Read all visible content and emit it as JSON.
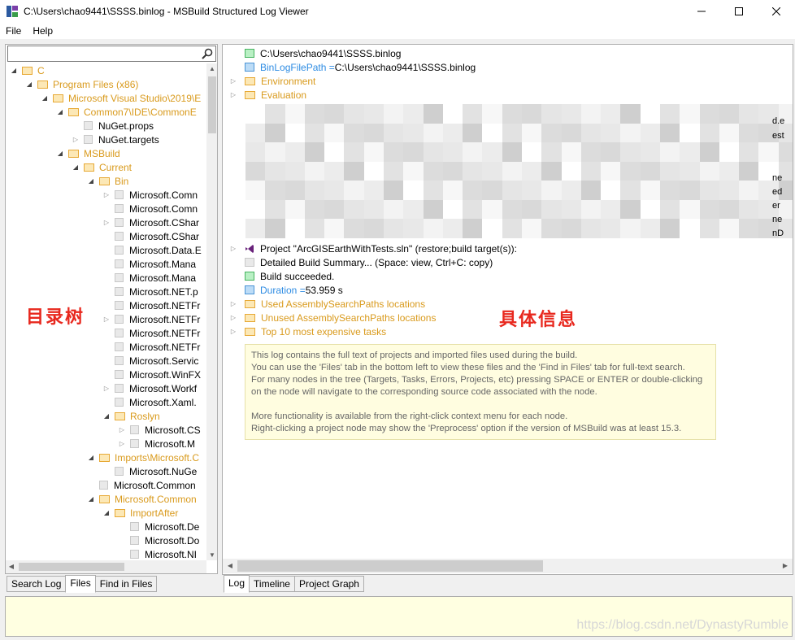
{
  "window": {
    "title": "C:\\Users\\chao9441\\SSSS.binlog - MSBuild Structured Log Viewer",
    "icon": "msbuild-app-icon"
  },
  "menu": [
    "File",
    "Help"
  ],
  "search": {
    "value": "",
    "placeholder": ""
  },
  "tree": [
    {
      "depth": 0,
      "label": "C",
      "kind": "folder",
      "expander": "open"
    },
    {
      "depth": 1,
      "label": "Program Files (x86)",
      "kind": "folder",
      "expander": "open"
    },
    {
      "depth": 2,
      "label": "Microsoft Visual Studio\\2019\\E",
      "kind": "folder",
      "expander": "open"
    },
    {
      "depth": 3,
      "label": "Common7\\IDE\\CommonE",
      "kind": "folder",
      "expander": "open"
    },
    {
      "depth": 4,
      "label": "NuGet.props",
      "kind": "file",
      "expander": "none"
    },
    {
      "depth": 4,
      "label": "NuGet.targets",
      "kind": "file",
      "expander": "closed"
    },
    {
      "depth": 3,
      "label": "MSBuild",
      "kind": "folder",
      "expander": "open"
    },
    {
      "depth": 4,
      "label": "Current",
      "kind": "folder",
      "expander": "open"
    },
    {
      "depth": 5,
      "label": "Bin",
      "kind": "folder",
      "expander": "open"
    },
    {
      "depth": 6,
      "label": "Microsoft.Comn",
      "kind": "file",
      "expander": "closed"
    },
    {
      "depth": 6,
      "label": "Microsoft.Comn",
      "kind": "file",
      "expander": "none"
    },
    {
      "depth": 6,
      "label": "Microsoft.CShar",
      "kind": "file",
      "expander": "closed"
    },
    {
      "depth": 6,
      "label": "Microsoft.CShar",
      "kind": "file",
      "expander": "none"
    },
    {
      "depth": 6,
      "label": "Microsoft.Data.E",
      "kind": "file",
      "expander": "none"
    },
    {
      "depth": 6,
      "label": "Microsoft.Mana",
      "kind": "file",
      "expander": "none"
    },
    {
      "depth": 6,
      "label": "Microsoft.Mana",
      "kind": "file",
      "expander": "none"
    },
    {
      "depth": 6,
      "label": "Microsoft.NET.p",
      "kind": "file",
      "expander": "none"
    },
    {
      "depth": 6,
      "label": "Microsoft.NETFr",
      "kind": "file",
      "expander": "none"
    },
    {
      "depth": 6,
      "label": "Microsoft.NETFr",
      "kind": "file",
      "expander": "closed"
    },
    {
      "depth": 6,
      "label": "Microsoft.NETFr",
      "kind": "file",
      "expander": "none"
    },
    {
      "depth": 6,
      "label": "Microsoft.NETFr",
      "kind": "file",
      "expander": "none"
    },
    {
      "depth": 6,
      "label": "Microsoft.Servic",
      "kind": "file",
      "expander": "none"
    },
    {
      "depth": 6,
      "label": "Microsoft.WinFX",
      "kind": "file",
      "expander": "none"
    },
    {
      "depth": 6,
      "label": "Microsoft.Workf",
      "kind": "file",
      "expander": "closed"
    },
    {
      "depth": 6,
      "label": "Microsoft.Xaml.",
      "kind": "file",
      "expander": "none"
    },
    {
      "depth": 6,
      "label": "Roslyn",
      "kind": "folder",
      "expander": "open"
    },
    {
      "depth": 7,
      "label": "Microsoft.CS",
      "kind": "file",
      "expander": "closed"
    },
    {
      "depth": 7,
      "label": "Microsoft.M",
      "kind": "file",
      "expander": "closed"
    },
    {
      "depth": 5,
      "label": "Imports\\Microsoft.C",
      "kind": "folder",
      "expander": "open"
    },
    {
      "depth": 6,
      "label": "Microsoft.NuGe",
      "kind": "file",
      "expander": "none"
    },
    {
      "depth": 5,
      "label": "Microsoft.Common",
      "kind": "file",
      "expander": "none"
    },
    {
      "depth": 5,
      "label": "Microsoft.Common",
      "kind": "folder",
      "expander": "open"
    },
    {
      "depth": 6,
      "label": "ImportAfter",
      "kind": "folder",
      "expander": "open"
    },
    {
      "depth": 7,
      "label": "Microsoft.De",
      "kind": "file",
      "expander": "none"
    },
    {
      "depth": 7,
      "label": "Microsoft.Do",
      "kind": "file",
      "expander": "none"
    },
    {
      "depth": 7,
      "label": "Microsoft.NI",
      "kind": "file",
      "expander": "none"
    }
  ],
  "left_tabs": [
    "Search Log",
    "Files",
    "Find in Files"
  ],
  "left_active_tab": "Files",
  "log": {
    "binlog_path": "C:\\Users\\chao9441\\SSSS.binlog",
    "binlog_prop_name": "BinLogFilePath = ",
    "binlog_prop_value": "C:\\Users\\chao9441\\SSSS.binlog",
    "environment": "Environment",
    "evaluation": "Evaluation",
    "side_fragments": [
      "d.e",
      "est",
      "ne",
      "ed",
      "er",
      "ne",
      "nD"
    ],
    "project": "Project \"ArcGISEarthWithTests.sln\" (restore;build target(s)):",
    "summary": "Detailed Build Summary... (Space: view, Ctrl+C: copy)",
    "build_status": "Build succeeded.",
    "duration_name": "Duration = ",
    "duration_value": "53.959 s",
    "used_paths": "Used AssemblySearchPaths locations",
    "unused_paths": "Unused AssemblySearchPaths locations",
    "top_tasks": "Top 10 most expensive tasks",
    "info": [
      "This log contains the full text of projects and imported files used during the build.",
      "You can use the 'Files' tab in the bottom left to view these files and the 'Find in Files' tab for full-text search.",
      "For many nodes in the tree (Targets, Tasks, Errors, Projects, etc) pressing SPACE or ENTER or double-clicking",
      "on the node will navigate to the corresponding source code associated with the node.",
      "",
      "More functionality is available from the right-click context menu for each node.",
      "Right-clicking a project node may show the 'Preprocess' option if the version of MSBuild was at least 15.3."
    ]
  },
  "right_tabs": [
    "Log",
    "Timeline",
    "Project Graph"
  ],
  "right_active_tab": "Log",
  "annotations": {
    "left": "目录树",
    "right": "具体信息"
  },
  "watermark": "https://blog.csdn.net/DynastyRumble",
  "colors": {
    "folder_text": "#d99a1c",
    "property_blue": "#2e8ce3",
    "annotation_red": "#e8281e",
    "info_bg": "#fffde0"
  }
}
